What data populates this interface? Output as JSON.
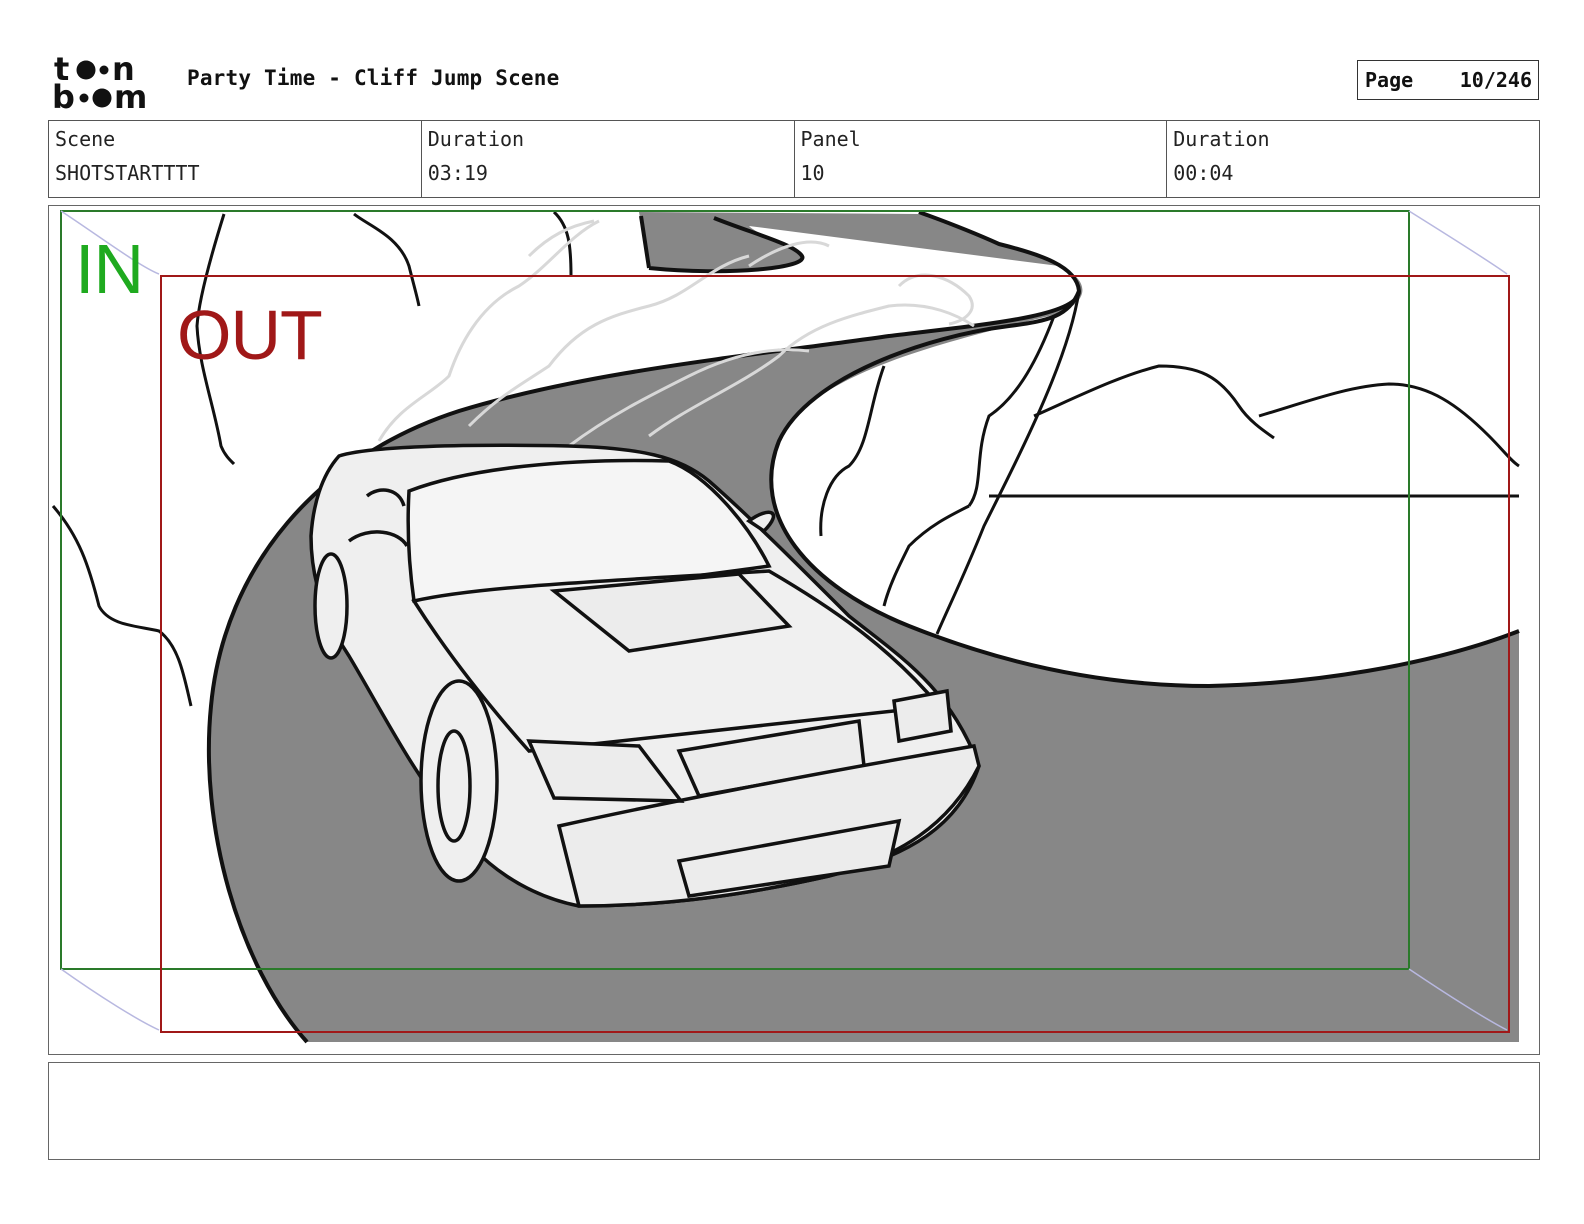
{
  "header": {
    "logo_text": "toonboom",
    "title": "Party Time - Cliff Jump Scene",
    "page_label": "Page",
    "page_number": "10/246"
  },
  "info": {
    "scene_label": "Scene",
    "scene_value": "SHOTSTARTTTT",
    "scene_duration_label": "Duration",
    "scene_duration_value": "03:19",
    "panel_label": "Panel",
    "panel_value": "10",
    "panel_duration_label": "Duration",
    "panel_duration_value": "00:04"
  },
  "frame": {
    "in_label": "IN",
    "out_label": "OUT",
    "in_color": "#1faa1f",
    "out_color": "#a01818"
  },
  "notes": {
    "text": ""
  }
}
